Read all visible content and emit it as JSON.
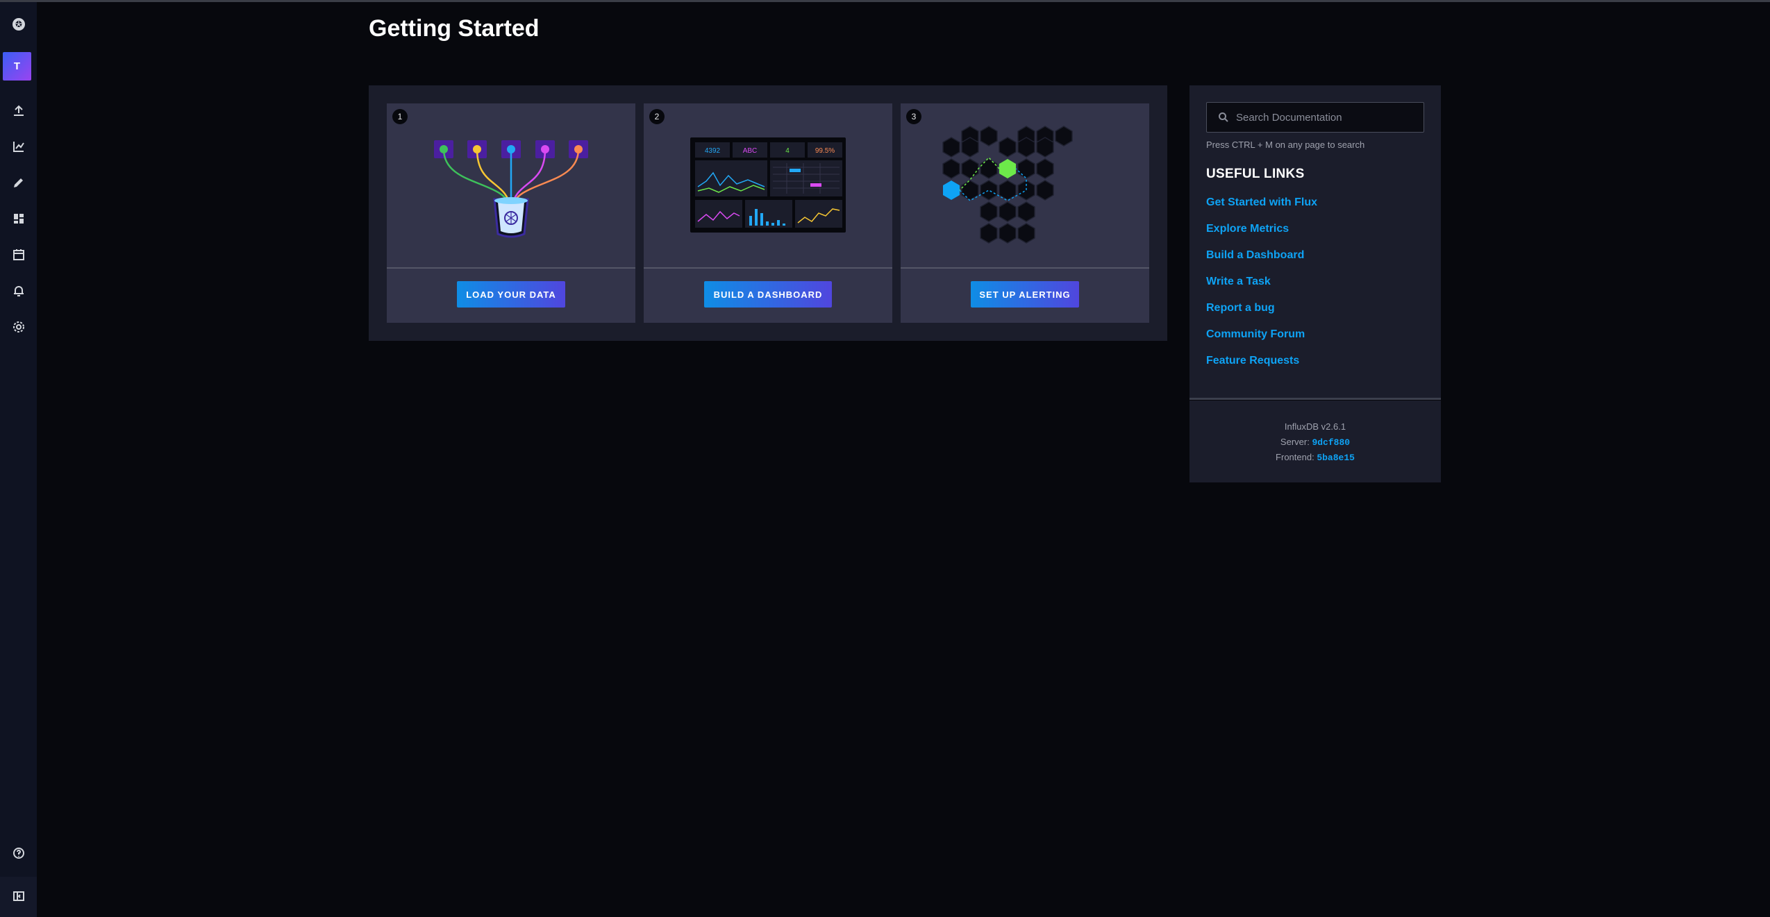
{
  "sidebar": {
    "org_initial": "T",
    "icons": [
      "influx-logo-icon",
      "upload-icon",
      "graph-icon",
      "pencil-icon",
      "dashboards-icon",
      "calendar-icon",
      "bell-icon",
      "gear-icon",
      "help-icon",
      "collapse-icon"
    ]
  },
  "page": {
    "title": "Getting Started"
  },
  "steps": [
    {
      "number": "1",
      "button": "LOAD YOUR DATA"
    },
    {
      "number": "2",
      "button": "BUILD A DASHBOARD"
    },
    {
      "number": "3",
      "button": "SET UP ALERTING"
    }
  ],
  "dashboard_preview": {
    "stat1": "4392",
    "stat2": "ABC",
    "stat3": "4",
    "stat4": "99.5%"
  },
  "docs": {
    "search_placeholder": "Search Documentation",
    "search_hint": "Press CTRL + M on any page to search",
    "useful_title": "USEFUL LINKS",
    "links": [
      "Get Started with Flux",
      "Explore Metrics",
      "Build a Dashboard",
      "Write a Task",
      "Report a bug",
      "Community Forum",
      "Feature Requests"
    ]
  },
  "version": {
    "product": "InfluxDB v2.6.1",
    "server_label": "Server:",
    "server_hash": "9dcf880",
    "frontend_label": "Frontend:",
    "frontend_hash": "5ba8e15"
  },
  "colors": {
    "accent": "#0ea3f5",
    "green": "#6de94a",
    "background": "#07080d"
  }
}
